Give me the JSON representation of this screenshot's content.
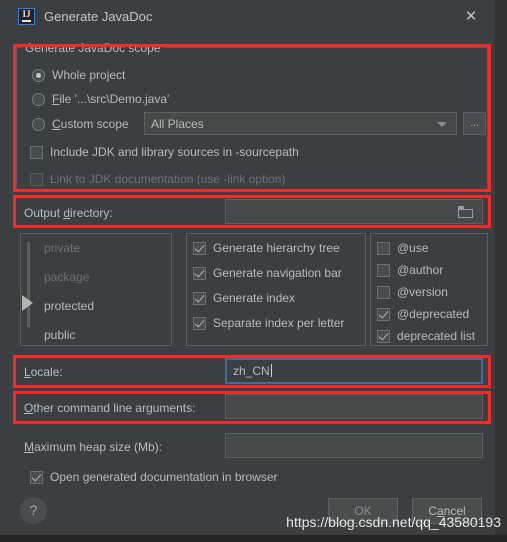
{
  "window": {
    "title": "Generate JavaDoc",
    "app_icon": "intellij-idea-icon",
    "icon_text": "IJ",
    "close_icon": "✕"
  },
  "scope": {
    "group_title": "Generate JavaDoc scope",
    "options": [
      {
        "label_pre": "Whole pro",
        "label_key": "j",
        "label_post": "ect",
        "selected": true
      },
      {
        "label_pre": "",
        "label_key": "F",
        "label_post": "ile '...\\src\\Demo.java'",
        "selected": false
      },
      {
        "label_pre": "",
        "label_key": "C",
        "label_post": "ustom scope",
        "selected": false
      }
    ],
    "custom_scope_value": "All Places",
    "browse_label": "...",
    "checkboxes": [
      {
        "label": "Include JDK and library sources in -sourcepath",
        "checked": false,
        "disabled": false
      },
      {
        "label": "Link to JDK documentation (use -link option)",
        "checked": false,
        "disabled": true
      }
    ]
  },
  "output": {
    "label_pre": "Output ",
    "label_key": "d",
    "label_post": "irectory:",
    "value": "",
    "browse_icon": "folder-icon"
  },
  "visibility": {
    "levels": [
      "private",
      "package",
      "protected",
      "public"
    ],
    "selected": "protected",
    "disabled": [
      "private",
      "package"
    ]
  },
  "generate_options": [
    {
      "label": "Generate hierarchy tree",
      "checked": true
    },
    {
      "label": "Generate navigation bar",
      "checked": true
    },
    {
      "label": "Generate index",
      "checked": true
    },
    {
      "label": "Separate index per letter",
      "checked": true
    }
  ],
  "tag_options": [
    {
      "label": "@use",
      "checked": false
    },
    {
      "label": "@author",
      "checked": false
    },
    {
      "label": "@version",
      "checked": false
    },
    {
      "label": "@deprecated",
      "checked": true
    },
    {
      "label": "deprecated list",
      "checked": true
    }
  ],
  "locale": {
    "label_key": "L",
    "label_post": "ocale:",
    "value": "zh_CN"
  },
  "other_args": {
    "label_key": "O",
    "label_post": "ther command line arguments:",
    "value": ""
  },
  "heap": {
    "label_key": "M",
    "label_post": "aximum heap size (Mb):",
    "value": ""
  },
  "open_in_browser": {
    "label_pre": "Open ",
    "label_key": "g",
    "label_post": "enerated documentation in browser",
    "checked": true
  },
  "footer": {
    "help_label": "?",
    "ok_label": "OK",
    "cancel_pre": "C",
    "cancel_key": "a",
    "cancel_post": "ncel"
  },
  "watermark": "https://blog.csdn.net/qq_43580193",
  "colors": {
    "dialog_bg": "#3c3f41",
    "annotation_red": "#fb2828",
    "focus_blue": "#3e6f9e",
    "text": "#bbbbbb"
  }
}
